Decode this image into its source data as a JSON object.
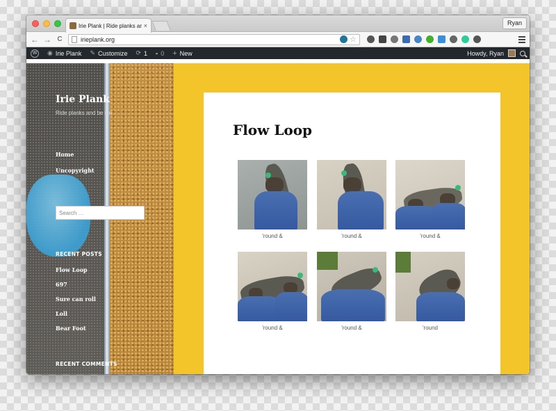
{
  "browser": {
    "tab_title": "Irie Plank | Ride planks and",
    "tab_close": "×",
    "profile_name": "Ryan",
    "url": "irieplank.org",
    "back": "←",
    "forward": "→",
    "reload": "C",
    "star": "☆"
  },
  "admin_bar": {
    "site_name": "Irie Plank",
    "customize": "Customize",
    "updates_count": "1",
    "comments_count": "0",
    "new_label": "New",
    "howdy": "Howdy, Ryan"
  },
  "sidebar": {
    "site_title": "Irie Plank",
    "site_description": "Ride planks and be irie",
    "nav": [
      "Home",
      "Uncopyright"
    ],
    "search_placeholder": "Search …",
    "recent_posts_title": "RECENT POSTS",
    "recent_posts": [
      "Flow Loop",
      "697",
      "Sure can roll",
      "Loll",
      "Bear Foot"
    ],
    "recent_comments_title": "RECENT COMMENTS"
  },
  "post": {
    "title": "Flow Loop",
    "gallery": [
      {
        "caption": "'round &"
      },
      {
        "caption": "'round &"
      },
      {
        "caption": "'round &"
      },
      {
        "caption": "'round &"
      },
      {
        "caption": "'round &"
      },
      {
        "caption": "'round"
      }
    ]
  },
  "colors": {
    "page_background": "#f3c52b",
    "admin_bar": "#23282d",
    "wp_blue": "#21759b"
  }
}
